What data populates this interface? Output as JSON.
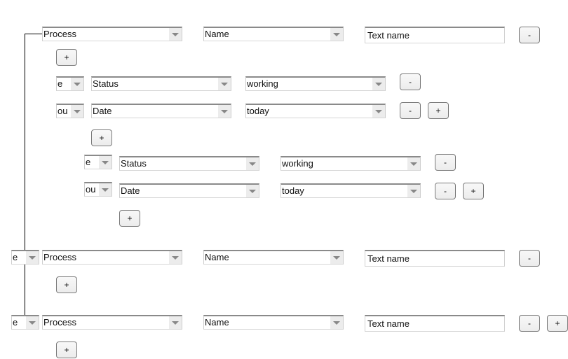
{
  "connector": {
    "color": "#000000"
  },
  "group1": {
    "field_select": "Process",
    "attr_select": "Name",
    "value_input": "Text name",
    "remove_label": "-",
    "add_label": "+",
    "conditions": [
      {
        "logic": "e",
        "field": "Status",
        "value": "working",
        "remove_label": "-"
      },
      {
        "logic": "ou",
        "field": "Date",
        "value": "today",
        "remove_label": "-",
        "add_label": "+"
      }
    ],
    "subgroup": {
      "add_label": "+",
      "conditions": [
        {
          "logic": "e",
          "field": "Status",
          "value": "working",
          "remove_label": "-"
        },
        {
          "logic": "ou",
          "field": "Date",
          "value": "today",
          "remove_label": "-",
          "add_label": "+"
        }
      ],
      "add_nested_label": "+"
    }
  },
  "group2": {
    "logic": "e",
    "field_select": "Process",
    "attr_select": "Name",
    "value_input": "Text name",
    "remove_label": "-",
    "add_label": "+"
  },
  "group3": {
    "logic": "e",
    "field_select": "Process",
    "attr_select": "Name",
    "value_input": "Text name",
    "remove_label": "-",
    "append_label": "+",
    "add_label": "+"
  }
}
